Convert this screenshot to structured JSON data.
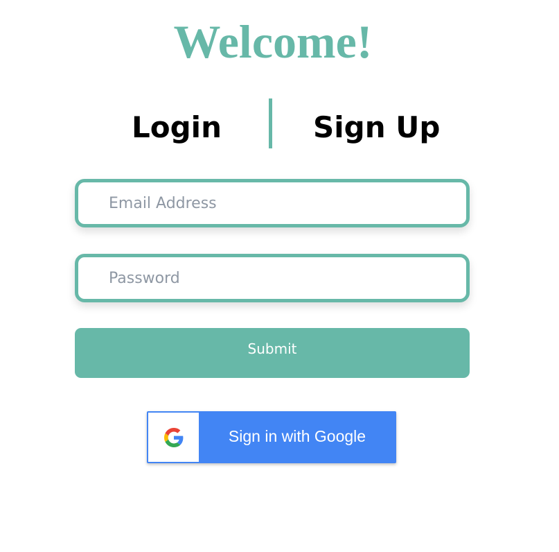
{
  "header": {
    "title": "Welcome!"
  },
  "tabs": {
    "login_label": "Login",
    "signup_label": "Sign Up"
  },
  "form": {
    "email": {
      "value": "",
      "placeholder": "Email Address"
    },
    "password": {
      "value": "",
      "placeholder": "Password"
    },
    "submit_label": "Submit"
  },
  "google": {
    "label": "Sign in with Google",
    "icon": "google-g-logo"
  },
  "colors": {
    "accent": "#67b8a8",
    "google_blue": "#4285f4",
    "placeholder": "#8e97a3"
  }
}
